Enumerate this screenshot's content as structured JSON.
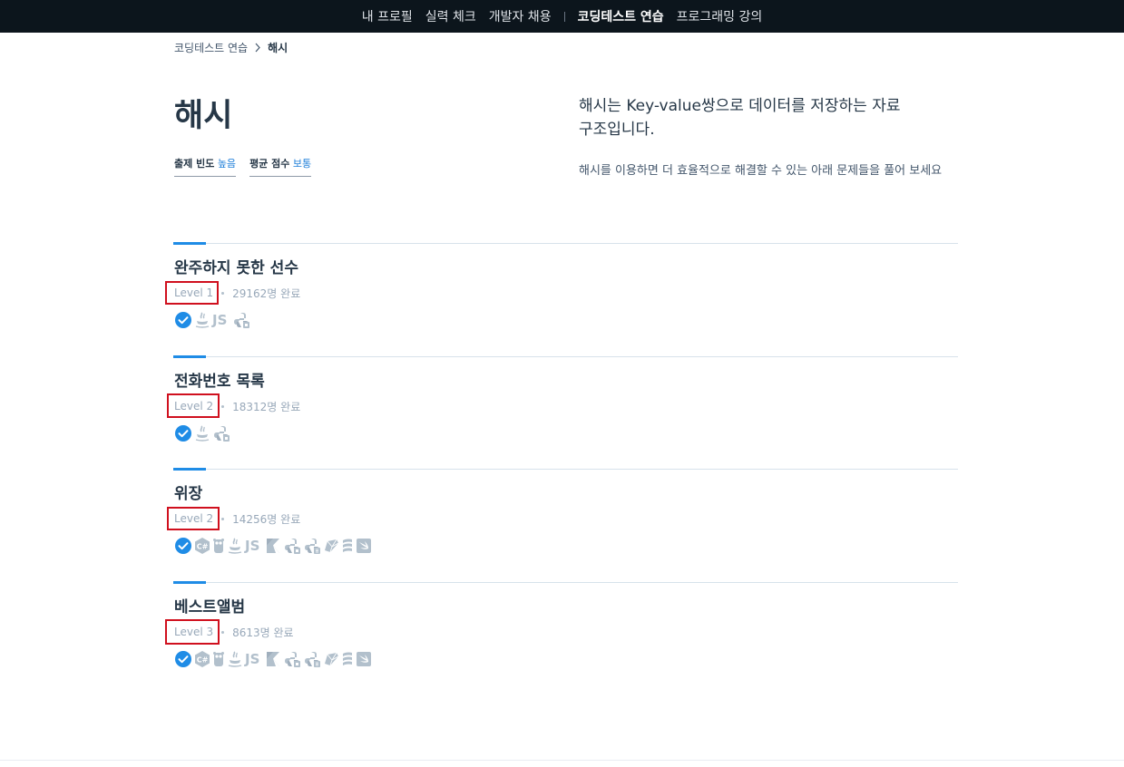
{
  "nav": {
    "items": [
      {
        "label": "내 프로필",
        "active": false
      },
      {
        "label": "실력 체크",
        "active": false
      },
      {
        "label": "개발자 채용",
        "active": false
      },
      {
        "label": "코딩테스트 연습",
        "active": true
      },
      {
        "label": "프로그래밍 강의",
        "active": false
      }
    ]
  },
  "breadcrumb": {
    "parent": "코딩테스트 연습",
    "current": "해시"
  },
  "header": {
    "title": "해시",
    "stats": [
      {
        "label": "출제 빈도",
        "value": "높음"
      },
      {
        "label": "평균 점수",
        "value": "보통"
      }
    ],
    "intro_title": "해시는 Key-value쌍으로 데이터를 저장하는 자료구조입니다.",
    "intro_desc": "해시를 이용하면 더 효율적으로 해결할 수 있는 아래 문제들을 풀어 보세요"
  },
  "problems": [
    {
      "title": "완주하지 못한 선수",
      "level": "Level 1",
      "completed": "29162명 완료",
      "languages": [
        "check-icon",
        "java-icon",
        "js-icon",
        "python-icon"
      ]
    },
    {
      "title": "전화번호 목록",
      "level": "Level 2",
      "completed": "18312명 완료",
      "languages": [
        "check-icon",
        "java-icon",
        "python-icon"
      ]
    },
    {
      "title": "위장",
      "level": "Level 2",
      "completed": "14256명 완료",
      "languages": [
        "check-icon",
        "csharp-icon",
        "go-icon",
        "java-icon",
        "js-icon",
        "kotlin-icon",
        "python-icon",
        "python3-icon",
        "ruby-icon",
        "scala-icon",
        "swift-icon"
      ]
    },
    {
      "title": "베스트앨범",
      "level": "Level 3",
      "completed": "8613명 완료",
      "languages": [
        "check-icon",
        "csharp-icon",
        "go-icon",
        "java-icon",
        "js-icon",
        "kotlin-icon",
        "python-icon",
        "python3-icon",
        "ruby-icon",
        "scala-icon",
        "swift-icon"
      ]
    }
  ],
  "colors": {
    "accent": "#1f8ce6",
    "nav_bg": "#0c151c",
    "highlight": "#d0101e",
    "icon_gray": "#b2c0cc"
  }
}
